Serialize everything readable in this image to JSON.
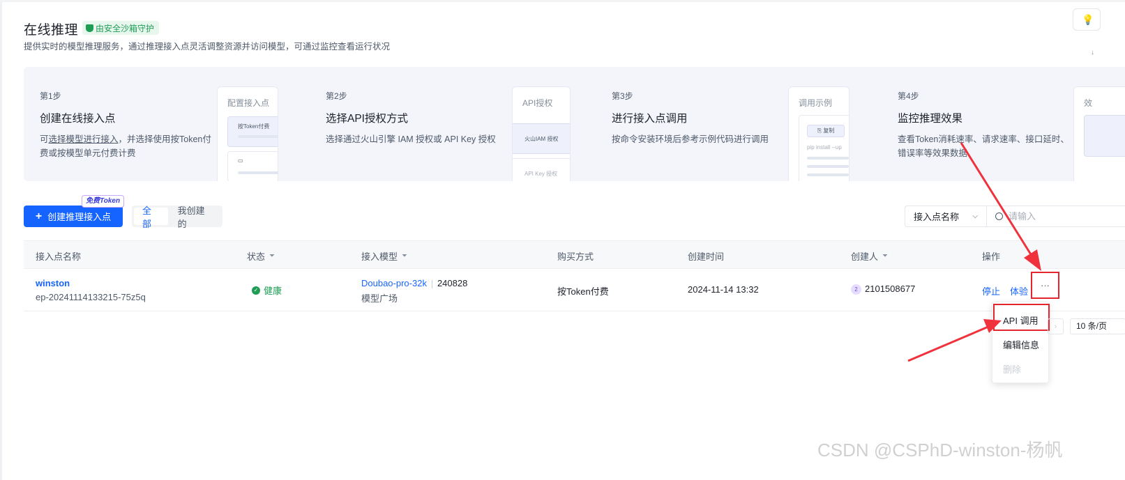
{
  "header": {
    "title": "在线推理",
    "badge": "由安全沙箱守护",
    "subtitle": "提供实时的模型推理服务，通过推理接入点灵活调整资源并访问模型，可通过监控查看运行状况"
  },
  "steps": [
    {
      "no": "第1步",
      "title": "创建在线接入点",
      "desc_prefix": "可",
      "desc_link": "选择模型进行接入",
      "desc_suffix": "，并选择使用按Token付费或按模型单元付费计费",
      "illus_title": "配置接入点",
      "illus_card": "按Token付费"
    },
    {
      "no": "第2步",
      "title": "选择API授权方式",
      "desc": "选择通过火山引擎 IAM 授权或 API Key 授权",
      "illus_title": "API授权",
      "illus_card": "火山IAM 授权",
      "illus_card2": "API Key 授权"
    },
    {
      "no": "第3步",
      "title": "进行接入点调用",
      "desc": "按命令安装环境后参考示例代码进行调用",
      "illus_title": "调用示例",
      "illus_copy": "复制",
      "illus_code": "pip install --up"
    },
    {
      "no": "第4步",
      "title": "监控推理效果",
      "desc": "查看Token消耗速率、请求速率、接口延时、错误率等效果数据",
      "illus_title": "效"
    }
  ],
  "toolbar": {
    "create_label": "创建推理接入点",
    "free_tag": "免费Token",
    "segments": [
      "全部",
      "我创建的"
    ],
    "filter_select": "接入点名称",
    "search_placeholder": "请输入"
  },
  "table": {
    "headers": [
      "接入点名称",
      "状态",
      "接入模型",
      "购买方式",
      "创建时间",
      "创建人",
      "操作"
    ],
    "rows": [
      {
        "name": "winston",
        "id": "ep-20241114133215-75z5q",
        "status": "健康",
        "model": "Doubao-pro-32k",
        "version": "240828",
        "source": "模型广场",
        "purchase": "按Token付费",
        "created": "2024-11-14 13:32",
        "creator_avatar": "2",
        "creator": "2101508677",
        "action_stop": "停止",
        "action_try": "体验",
        "action_more": "···"
      }
    ]
  },
  "dropdown": {
    "items": [
      "API 调用",
      "编辑信息",
      "删除"
    ]
  },
  "pagination": {
    "next": "›",
    "page_size": "10 条/页"
  },
  "watermark": "CSDN @CSPhD-winston-杨帆",
  "colors": {
    "primary": "#1664ff",
    "success": "#1f9d55",
    "annotation": "#e5252e"
  }
}
